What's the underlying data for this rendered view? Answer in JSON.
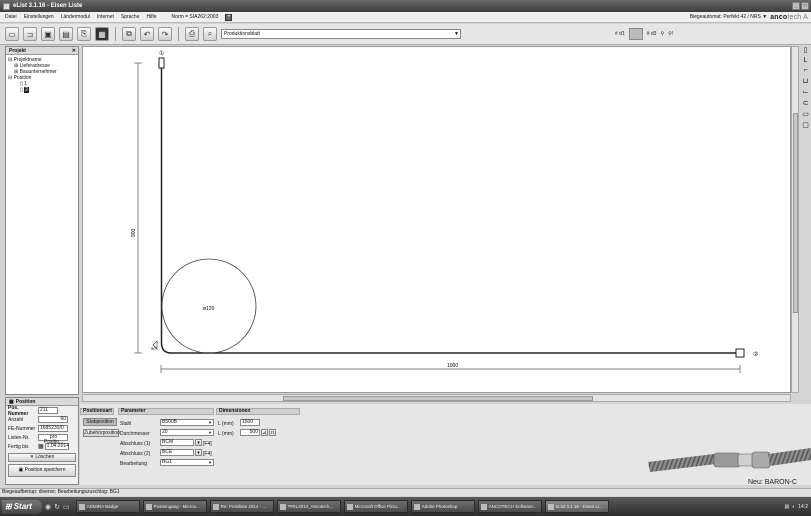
{
  "window": {
    "title": "eList 3.1.16 - Eisen Liste"
  },
  "menu": {
    "items": [
      "Datei",
      "Einstellungen",
      "Ländermodul",
      "Internet",
      "Sprache",
      "Hilfe"
    ],
    "norm": "Norm = SIA262:2003",
    "bending_machine": "Biegeautomat:  Perfekt 42 / NRS ▼",
    "logo_main": "anco",
    "logo_tail": "tech A"
  },
  "toolbar": {
    "sheet_select": "Produktionsblatt",
    "tool_d1": "# d1",
    "tool_d3": "# d3"
  },
  "project_panel": {
    "title": "Projekt",
    "tree": [
      "Projektname",
      "Lieferadresse",
      "Bauunternehmer",
      "Position",
      "1",
      "2"
    ]
  },
  "drawing": {
    "marker_top": "①",
    "marker_end": "②",
    "dim_vertical": "900",
    "dim_horizontal": "1000",
    "circle_label": "ø120",
    "corner_label": "90°"
  },
  "position_panel": {
    "title": "Position",
    "pos_nummer_label": "Pos. Nummer",
    "pos_nummer": "211",
    "anzahl_label": "Anzahl",
    "anzahl": "60",
    "fe_nummer_label": "FE-Nummer",
    "fe_nummer": "1685230/0",
    "listen_label": "Listen-Nr.",
    "listen_button": "pro Positio...",
    "fertig_label": "Fertig bis",
    "fertig": "1.04.2014",
    "delete_button": "Löschen",
    "save_button": "Position speichern"
  },
  "positionsart": {
    "title": "Positionsart",
    "stab_button": "Stabposition",
    "zubehor_button": "Zubehörposition"
  },
  "parameter": {
    "title": "Parameter",
    "stahl_label": "Stahl",
    "stahl": "B500B",
    "durchmesser_label": "Durchmesser",
    "durchmesser": "20",
    "abschluss1_label": "Abschluss (1)",
    "abschluss1": "BCM",
    "abschluss1_key": "[F4]",
    "abschluss2_label": "Abschluss (2)",
    "abschluss2": "BCE",
    "abschluss2_key": "[F4]",
    "bearbeitung_label": "Bearbeitung",
    "bearbeitung": "BG1"
  },
  "dimensionen": {
    "title": "Dimensionen",
    "l1_label": "L (mm)",
    "l1": "1500",
    "l2_label": "L (mm)",
    "l2": "500"
  },
  "promo": {
    "text": "Neu: BARON-C"
  },
  "status": {
    "text": "Biegeaufbetrup: diverse; Bearbeitungszuschlag: BG1"
  },
  "taskbar": {
    "start": "Start",
    "tasks": [
      "ADMIRA Badge",
      "Posteingang - Micros...",
      "Re: Preisliste 2014 - ...",
      "*PRL2014_Ancotech...",
      "Microsoft Office Pictu...",
      "Adobe Photoshop",
      "ANCOTECH Software...",
      "eList 3.1.16 - Eisen Li..."
    ],
    "clock": "14:2"
  },
  "colors": {
    "titlebar": "#4a4a4a",
    "canvas": "#ffffff",
    "panel": "#e6e6e6"
  }
}
